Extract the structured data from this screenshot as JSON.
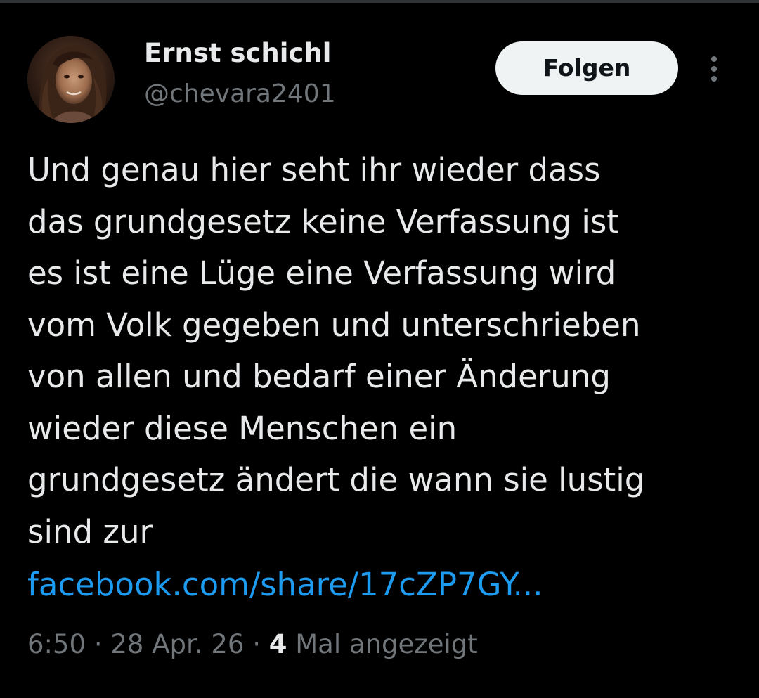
{
  "author": {
    "display_name": "Ernst schichl",
    "handle": "@chevara2401"
  },
  "actions": {
    "follow_label": "Folgen",
    "more_icon": "more-vertical-icon"
  },
  "tweet": {
    "text": "Und genau hier seht ihr wieder dass\ndas grundgesetz keine Verfassung ist\nes ist eine Lüge eine Verfassung wird\nvom Volk gegeben und unterschrieben\nvon allen und bedarf einer Änderung\nwieder diese Menschen ein\ngrundgesetz ändert die wann sie lustig\nsind zur",
    "link_text": "facebook.com/share/17cZP7GY..."
  },
  "meta": {
    "time": "6:50",
    "separator": " · ",
    "date": "28 Apr. 26",
    "views_count": "4",
    "views_label": " Mal angezeigt"
  },
  "colors": {
    "background": "#000000",
    "text_primary": "#e7e9ea",
    "text_secondary": "#71767b",
    "link": "#1d9bf0",
    "follow_button_bg": "#eff3f4",
    "follow_button_text": "#0f1419"
  }
}
